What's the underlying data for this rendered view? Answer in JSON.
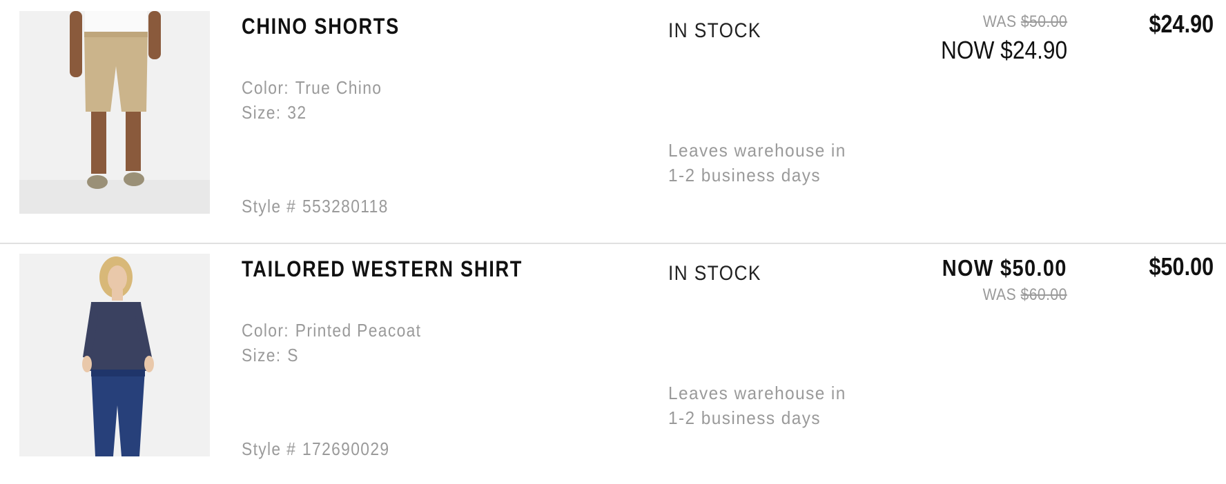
{
  "items": [
    {
      "name": "CHINO SHORTS",
      "color_label": "Color:",
      "color_value": "True Chino",
      "size_label": "Size:",
      "size_value": "32",
      "style_label": "Style #",
      "style_value": "553280118",
      "stock": "IN STOCK",
      "leaves": "Leaves warehouse in 1-2 business days",
      "was_label": "WAS",
      "was_price": "$50.00",
      "now_label": "NOW",
      "now_price": "$24.90",
      "total": "$24.90",
      "image_icon": "khaki-shorts-product-photo"
    },
    {
      "name": "TAILORED WESTERN SHIRT",
      "color_label": "Color:",
      "color_value": "Printed Peacoat",
      "size_label": "Size:",
      "size_value": "S",
      "style_label": "Style #",
      "style_value": "172690029",
      "stock": "IN STOCK",
      "leaves": "Leaves warehouse in 1-2 business days",
      "was_label": "WAS",
      "was_price": "$60.00",
      "now_label": "NOW",
      "now_price": "$50.00",
      "total": "$50.00",
      "image_icon": "navy-western-shirt-product-photo"
    }
  ],
  "colors": {
    "text_primary": "#111111",
    "text_muted": "#9a9a9a",
    "divider": "#e0e0e0",
    "image_bg": "#efefef"
  }
}
